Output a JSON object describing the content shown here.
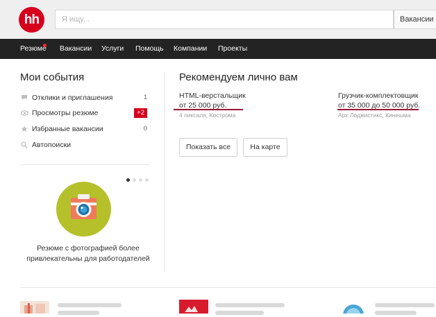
{
  "header": {
    "logo_text": "hh",
    "search_placeholder": "Я ищу...",
    "search_scope": "Вакансии"
  },
  "nav": {
    "items": [
      "Резюме",
      "Вакансии",
      "Услуги",
      "Помощь",
      "Компании",
      "Проекты"
    ],
    "notification_color": "#ff2b2b"
  },
  "events": {
    "title": "Мои события",
    "items": [
      {
        "label": "Отклики и приглашения",
        "count": "1",
        "icon": "comment-icon"
      },
      {
        "label": "Просмотры резюме",
        "count": "+2",
        "icon": "eye-icon"
      },
      {
        "label": "Избранные вакансии",
        "count": "0",
        "icon": "star-icon"
      },
      {
        "label": "Автопоиски",
        "count": "",
        "icon": "search-icon"
      }
    ],
    "promo_text": "Резюме с фотографией более привлекательны для работодателей"
  },
  "recommend": {
    "title": "Рекомендуем лично вам",
    "vacancies": [
      {
        "title": "HTML-верстальщик",
        "salary": "от 25 000 руб.",
        "employer": "4 пиксаля, Кострома"
      },
      {
        "title": "Грузчик-комплектовщик",
        "salary": "от 35 000 до 50 000 руб.",
        "employer": "Арх Лоджистикс, Кинешма"
      }
    ],
    "show_all": "Показать все",
    "on_map": "На карте"
  },
  "colors": {
    "brand": "#d6001c",
    "nav_bg": "#232323",
    "underline": "#9c1236",
    "camera_bg": "#b6c02a"
  }
}
